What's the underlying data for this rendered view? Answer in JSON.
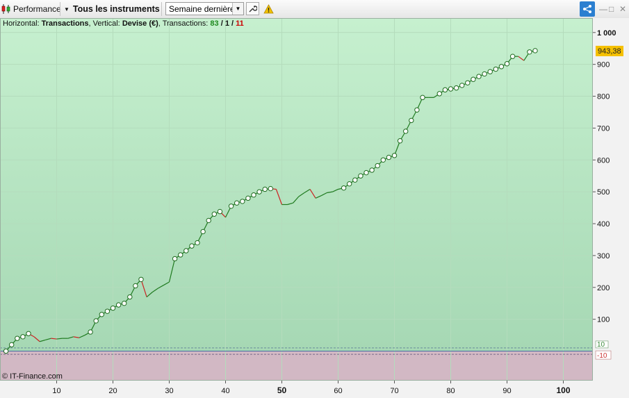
{
  "toolbar": {
    "performance_label": "Performance",
    "instruments_label": "Tous les instruments",
    "period_value": "Semaine dernière",
    "window_controls": [
      "—",
      "□",
      "✕"
    ]
  },
  "header": {
    "horizontal_label": "Horizontal:",
    "horizontal_value": "Transactions",
    "vertical_label": ", Vertical:",
    "vertical_value": "Devise (€)",
    "transactions_label": ", Transactions:",
    "count_total": "83",
    "sep1": "/",
    "count_neutral": "1",
    "sep2": "/",
    "count_loss": "11"
  },
  "credit": "© IT-Finance.com",
  "colors": {
    "gain": "#1f7a1f",
    "loss": "#cc2222",
    "bg_top": "#c6f0cf",
    "bg_bottom": "#a6d8b4",
    "loss_zone": "#d2b8c4",
    "current_badge": "#f5c000"
  },
  "chart_data": {
    "type": "line",
    "xlabel": "",
    "ylabel": "",
    "xlim": [
      0,
      105
    ],
    "ylim": [
      -90,
      1020
    ],
    "x_ticks": [
      "10",
      "20",
      "30",
      "40",
      "50",
      "60",
      "70",
      "80",
      "90",
      "100"
    ],
    "y_ticks": [
      "100",
      "200",
      "300",
      "400",
      "500",
      "600",
      "700",
      "800",
      "900",
      "1 000"
    ],
    "current_value_label": "943,38",
    "upper_band_label": "10",
    "lower_band_label": "-10",
    "series": [
      {
        "x": [
          1,
          2,
          3,
          4,
          5,
          6,
          7,
          8,
          9,
          10,
          11,
          12,
          13,
          14,
          15,
          16,
          17,
          18,
          19,
          20,
          21,
          22,
          23,
          24,
          25,
          26,
          27,
          28,
          29,
          30,
          31,
          32,
          33,
          34,
          35,
          36,
          37,
          38,
          39,
          40,
          41,
          42,
          43,
          44,
          45,
          46,
          47,
          48,
          49,
          50,
          51,
          52,
          53,
          54,
          55,
          56,
          57,
          58,
          59,
          60,
          61,
          62,
          63,
          64,
          65,
          66,
          67,
          68,
          69,
          70,
          71,
          72,
          73,
          74,
          75,
          76,
          77,
          78,
          79,
          80,
          81,
          82,
          83,
          84,
          85,
          86,
          87,
          88,
          89,
          90,
          91,
          92,
          93,
          94,
          95
        ],
        "y": [
          0,
          20,
          40,
          45,
          55,
          45,
          30,
          35,
          40,
          38,
          40,
          40,
          45,
          42,
          50,
          60,
          95,
          115,
          125,
          135,
          145,
          150,
          170,
          205,
          225,
          170,
          185,
          197,
          207,
          217,
          290,
          302,
          315,
          330,
          340,
          375,
          410,
          430,
          438,
          420,
          455,
          465,
          470,
          480,
          490,
          500,
          508,
          510,
          508,
          460,
          460,
          465,
          485,
          497,
          508,
          480,
          488,
          497,
          500,
          508,
          512,
          525,
          537,
          550,
          560,
          568,
          582,
          600,
          608,
          614,
          660,
          690,
          724,
          757,
          796,
          796,
          796,
          808,
          820,
          823,
          826,
          834,
          842,
          853,
          862,
          870,
          877,
          885,
          893,
          902,
          925,
          925,
          912,
          939,
          943
        ]
      }
    ]
  }
}
